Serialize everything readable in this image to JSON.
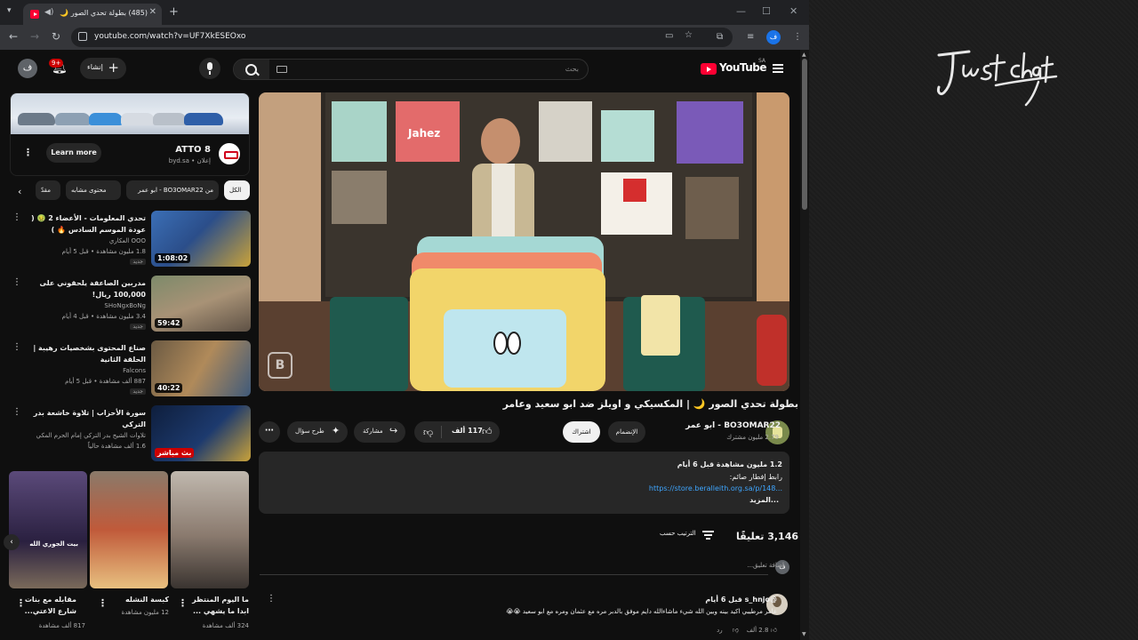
{
  "browser": {
    "tab_title": "(485) بطولة تحدي الصور 🌙",
    "url": "youtube.com/watch?v=UF7XkESEOxo",
    "profile_initial": "ف"
  },
  "header": {
    "avatar_initial": "ف",
    "notifications": "9+",
    "create_label": "إنشاء",
    "search_placeholder": "بحث",
    "logo_text": "YouTube",
    "logo_region": "SA"
  },
  "ad": {
    "title": "ATTO 8",
    "sponsor": "byd.sa • إعلان",
    "cta": "Learn more"
  },
  "chips": [
    "الكل",
    "من BO3OMAR22 - ابو عمر",
    "محتوى مشابه",
    "مقدّ"
  ],
  "related": [
    {
      "title": "تحدي المعلومات - الأعضاء 2 🤢 ( عودة الموسم السادس 🔥 )",
      "channel": "العكاري OOO",
      "meta": "1.8 مليون مشاهدة • قبل 5 أيام",
      "badge": "جديد",
      "duration": "1:08:02"
    },
    {
      "title": "مدربين الصاعقة يلحقوني على 100,000 ريال!",
      "channel": "SHoNgxBoNg",
      "meta": "3.4 مليون مشاهدة • قبل 4 أيام",
      "badge": "جديد",
      "duration": "59:42"
    },
    {
      "title": "صناع المحتوى بشخصيات رهيبة | الحلقة الثانية",
      "channel": "Falcons",
      "meta": "887 ألف مشاهدة • قبل 5 أيام",
      "badge": "جديد",
      "duration": "40:22"
    },
    {
      "title": "سورة الأحزاب | تلاوة خاشعة بدر التركي",
      "channel": "تلاوات الشيخ بدر التركي إمام الحرم المكي",
      "meta": "1.6 ألف مشاهدة حالياً",
      "badge": "",
      "duration": "بث مباشر"
    }
  ],
  "shorts": [
    {
      "title": "مقابله مع بنات شارع الاعتي...",
      "meta": "817 ألف مشاهدة",
      "caption": "بيت الجوري الله"
    },
    {
      "title": "كبسة النشله",
      "meta": "12 مليون مشاهدة",
      "caption": ""
    },
    {
      "title": "ما اليوم المنتظر ابدا ما يشهي ...",
      "meta": "324 ألف مشاهدة",
      "caption": ""
    }
  ],
  "player": {
    "watermark": "B"
  },
  "video": {
    "title": "بطولة تحدي الصور 🌙 | المكسيكي و اويلز ضد ابو سعيد وعامر",
    "channel": "BO3OMAR22 - ابو عمر",
    "subscribers": "2.79 مليون مشترك",
    "join": "الإنضمام",
    "subscribe": "اشتراك",
    "likes": "117 ألف",
    "share": "مشاركة",
    "ask": "طرح سؤال"
  },
  "description": {
    "stats": "1.2 مليون مشاهدة  قبل 6 أيام",
    "line": "رابط إفطار صائم:",
    "link": "https://store.beralleith.org.sa/p/148...",
    "more": "...المزيد"
  },
  "comments": {
    "count": "3,146 تعليقًا",
    "sort": "الترتيب حسب",
    "add_placeholder": "إضافة تعليق...",
    "add_initial": "ف",
    "first": {
      "author": "@s_hnjo قبل 6 أيام",
      "text": "عامر مرطيبي اكيد بينه وبين الله شيء ماشاءالله دايم موفق بالدبر مره مع عثمان ومره مع ابو سعيد 😭😭",
      "likes": "2.8 ألف",
      "reply": "رد"
    }
  },
  "colors": {
    "brand_red": "#ff0033",
    "link_blue": "#3ea6ff",
    "bg": "#0f0f0f"
  }
}
